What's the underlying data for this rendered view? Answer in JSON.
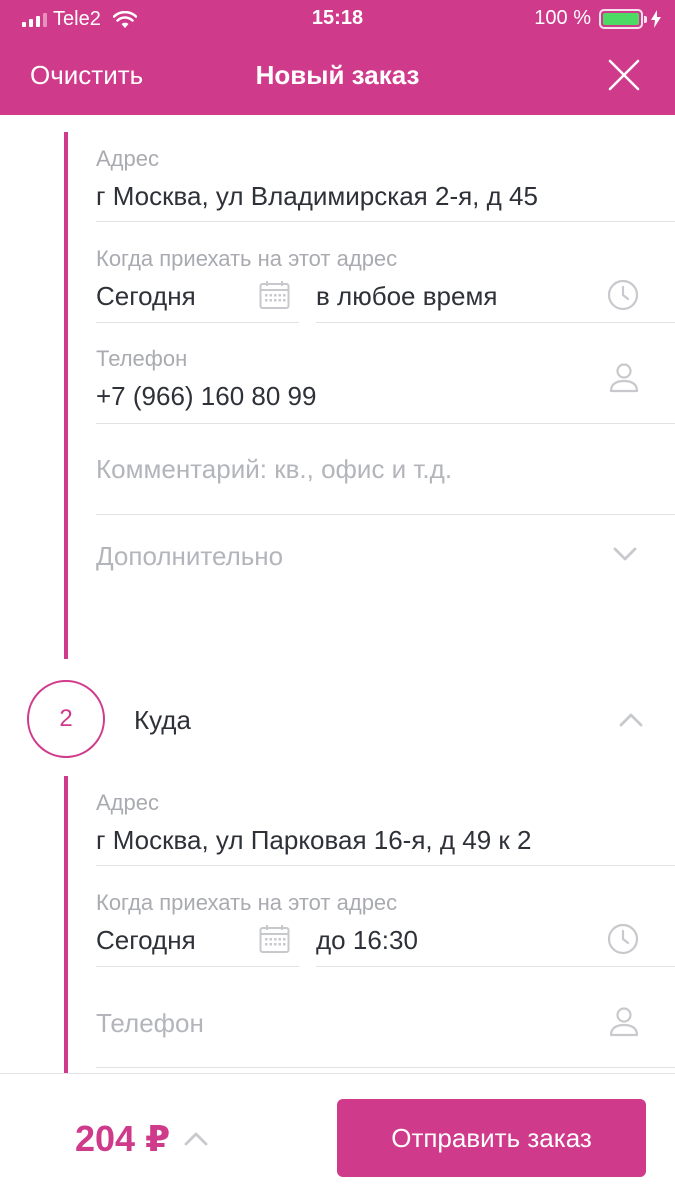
{
  "status_bar": {
    "carrier": "Tele2",
    "time": "15:18",
    "battery": "100 %",
    "battery_level": 1.0
  },
  "header": {
    "clear_label": "Очистить",
    "title": "Новый заказ",
    "close_icon": "close-icon"
  },
  "colors": {
    "accent": "#cf3a8b",
    "text": "#2e3138",
    "muted": "#a9abb1",
    "divider": "#e2e2e5"
  },
  "pickup": {
    "address_label": "Адрес",
    "address_value": "г Москва, ул Владимирская 2-я, д 45",
    "when_label": "Когда приехать на этот адрес",
    "date_value": "Сегодня",
    "time_value": "в любое время",
    "phone_label": "Телефон",
    "phone_value": "+7 (966) 160 80 99",
    "comment_placeholder": "Комментарий: кв., офис и т.д.",
    "more_label": "Дополнительно"
  },
  "destination": {
    "step_number": "2",
    "step_title": "Куда",
    "address_label": "Адрес",
    "address_value": "г Москва, ул Парковая 16-я, д 49 к 2",
    "when_label": "Когда приехать на этот адрес",
    "date_value": "Сегодня",
    "time_value": "до 16:30",
    "phone_placeholder": "Телефон"
  },
  "footer": {
    "price": "204 ₽",
    "submit_label": "Отправить заказ"
  }
}
